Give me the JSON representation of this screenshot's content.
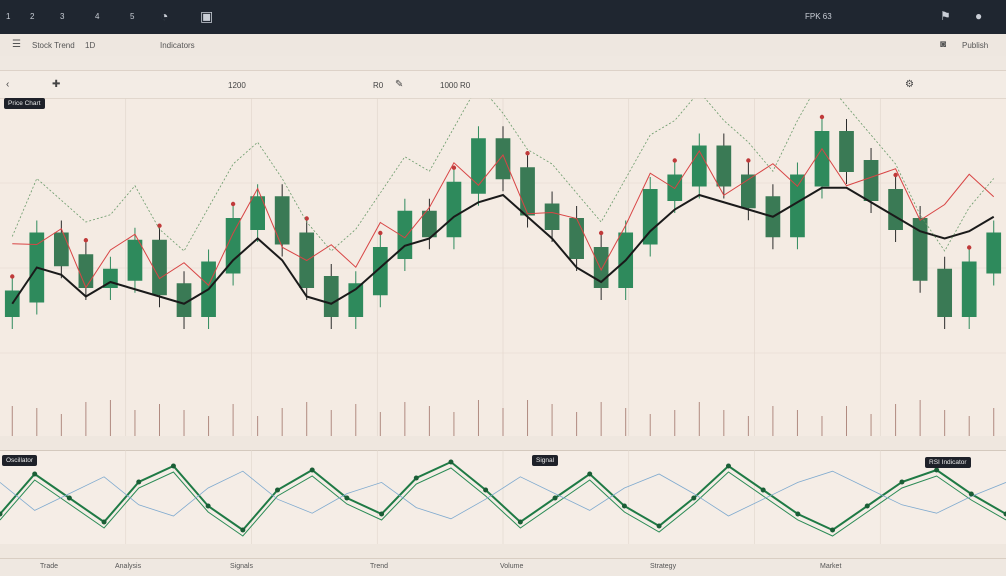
{
  "topbar": {
    "items": [
      "1",
      "2",
      "3",
      "4",
      "5"
    ],
    "right_label": "FPK 63",
    "right_icons": [
      "bell-icon",
      "user-icon"
    ]
  },
  "toolbar": {
    "symbol": "Stock Trend",
    "interval": "1D",
    "indicator_label": "Indicators",
    "right_button": "Publish"
  },
  "quotebar": {
    "left_value": "1200",
    "mid_value": "R0",
    "right_value": "1000 R0"
  },
  "chips": {
    "price_tag": "Price Chart",
    "volume_tag": "Volume",
    "oscillator_left": "Oscillator",
    "oscillator_mid": "Signal",
    "oscillator_right": "RSI Indicator"
  },
  "bottombar": {
    "labels": [
      "Trade",
      "Analysis",
      "Signals",
      "Trend",
      "Volume",
      "Strategy",
      "Market"
    ]
  },
  "colors": {
    "bull": "#2e8a5c",
    "bear": "#c03a3a",
    "ma_black": "#1a1a1a",
    "ma_red": "#d84545",
    "osc_green": "#1f7a45",
    "volume_bar": "#b08a80"
  },
  "chart_data": [
    {
      "type": "candlestick",
      "series": [
        {
          "name": "Price",
          "values": [
            14,
            22,
            19,
            16,
            17,
            21,
            15,
            12,
            18,
            24,
            27,
            22,
            16,
            12,
            15,
            20,
            25,
            23,
            29,
            35,
            31,
            26,
            24,
            20,
            16,
            22,
            28,
            30,
            34,
            30,
            27,
            23,
            30,
            36,
            32,
            28,
            24,
            17,
            12,
            18,
            22
          ]
        },
        {
          "name": "MA",
          "values": [
            13,
            18,
            17,
            14,
            16,
            15,
            14,
            13,
            15,
            19,
            22,
            19,
            14,
            13,
            15,
            18,
            21,
            22,
            25,
            27,
            28,
            25,
            22,
            18,
            16,
            19,
            23,
            26,
            28,
            27,
            26,
            25,
            27,
            29,
            29,
            27,
            25,
            23,
            22,
            23,
            25
          ]
        }
      ],
      "ylim": [
        0,
        40
      ]
    },
    {
      "type": "line",
      "series": [
        {
          "name": "Oscillator",
          "values": [
            0.3,
            0.8,
            0.5,
            0.2,
            0.7,
            0.9,
            0.4,
            0.1,
            0.6,
            0.85,
            0.5,
            0.3,
            0.75,
            0.95,
            0.6,
            0.2,
            0.5,
            0.8,
            0.4,
            0.15,
            0.5,
            0.9,
            0.6,
            0.3,
            0.1,
            0.4,
            0.7,
            0.85,
            0.55,
            0.3
          ]
        }
      ],
      "ylim": [
        0,
        1
      ]
    }
  ]
}
